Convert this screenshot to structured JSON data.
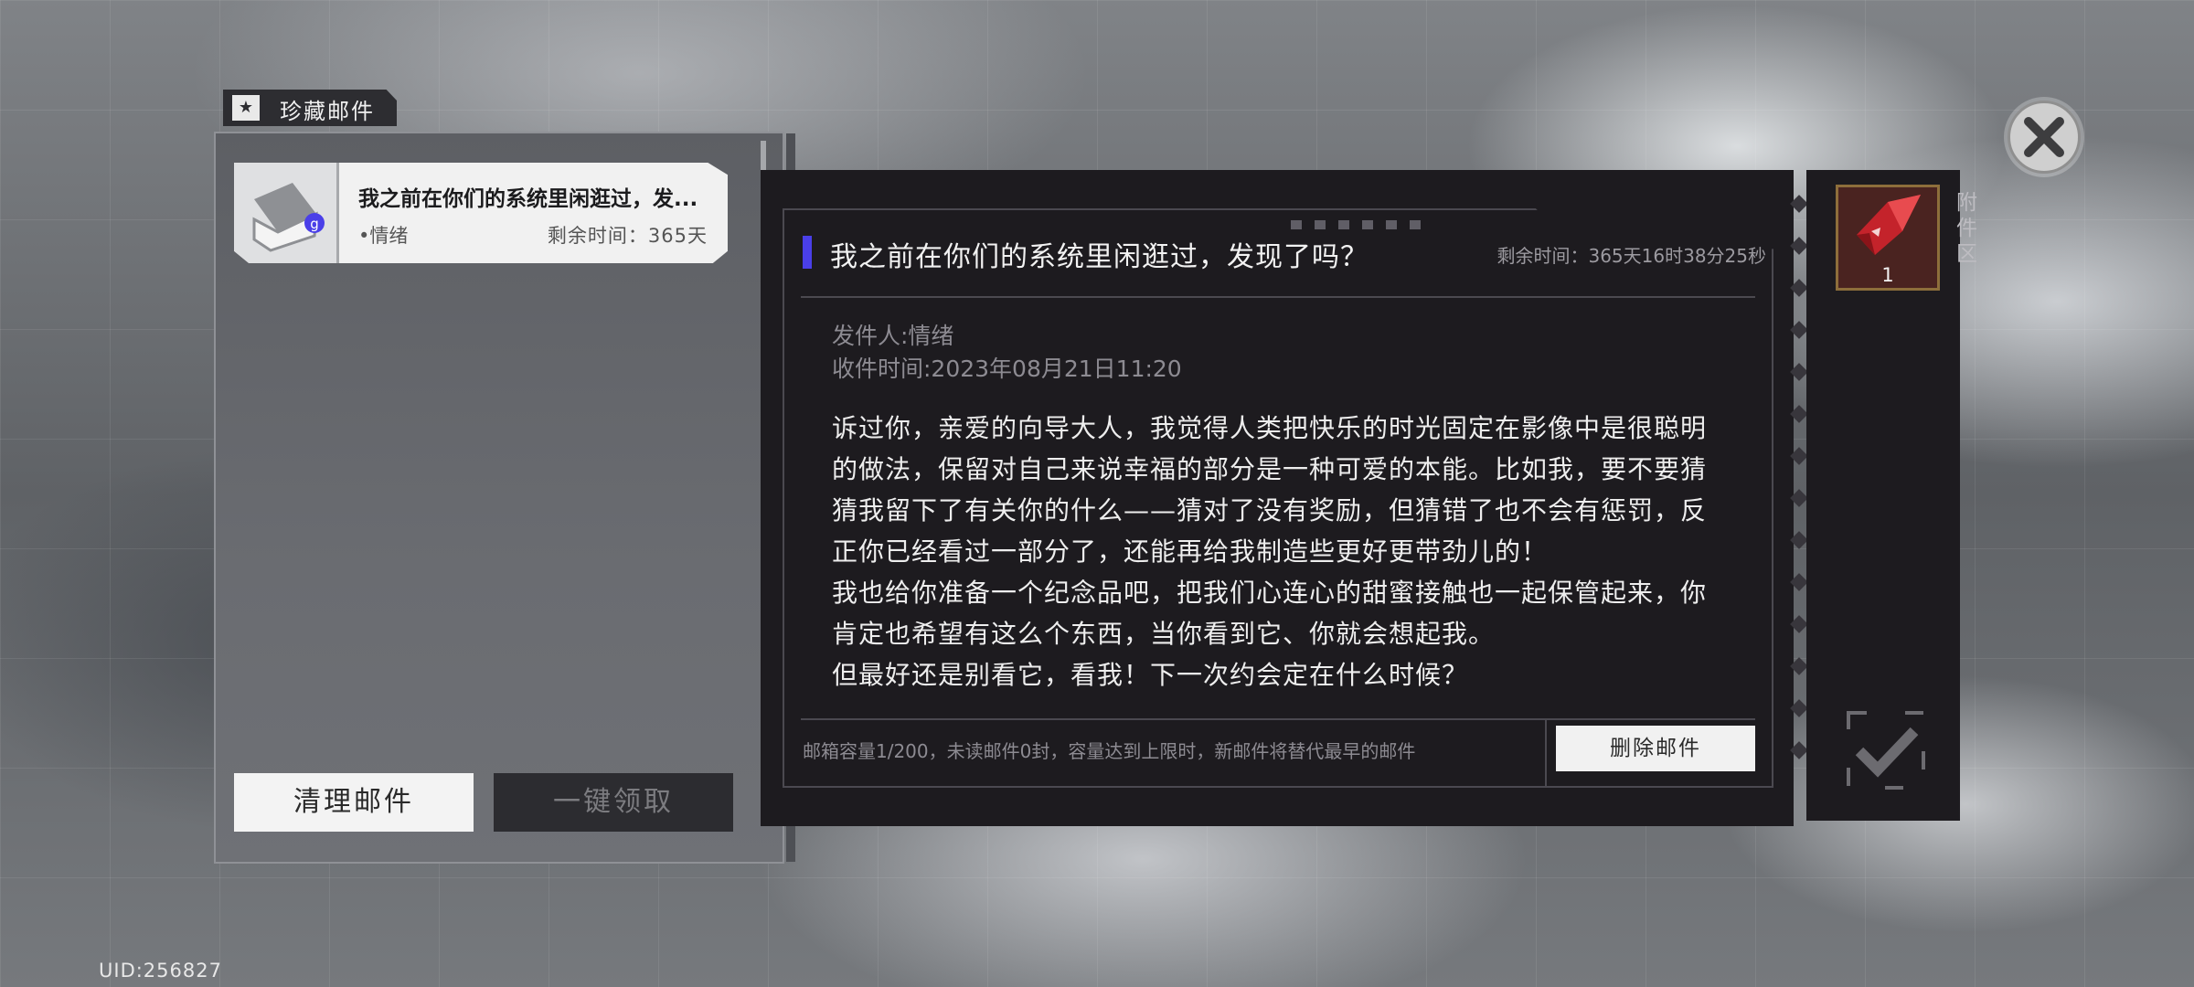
{
  "footer": {
    "uid": "UID:256827"
  },
  "list_panel": {
    "tab_label": "珍藏邮件",
    "mail_items": [
      {
        "subject": "我之前在你们的系统里闲逛过，发...",
        "sender": "•情绪",
        "remain": "剩余时间：365天"
      }
    ],
    "clean_label": "清理邮件",
    "claim_label": "一键领取"
  },
  "detail": {
    "title": "我之前在你们的系统里闲逛过，发现了吗？",
    "remain_full": "剩余时间：365天16时38分25秒",
    "sender": "发件人:情绪",
    "received": "收件时间:2023年08月21日11:20",
    "body": [
      "诉过你，亲爱的向导大人，我觉得人类把快乐的时光固定在影像中是很聪明的做法，保留对自己来说幸福的部分是一种可爱的本能。比如我，要不要猜猜我留下了有关你的什么——猜对了没有奖励，但猜错了也不会有惩罚，反正你已经看过一部分了，还能再给我制造些更好更带劲儿的！",
      "我也给你准备一个纪念品吧，把我们心连心的甜蜜接触也一起保管起来，你肯定也希望有这么个东西，当你看到它、你就会想起我。",
      "但最好还是别看它，看我！下一次约会定在什么时候？"
    ],
    "capacity": "邮箱容量1/200，未读邮件0封，容量达到上限时，新邮件将替代最早的邮件",
    "delete_label": "删除邮件"
  },
  "attachment": {
    "label": "附件区",
    "item_icon": "red-crystal-icon",
    "item_count": "1"
  },
  "colors": {
    "accent": "#4a3fe8",
    "panel": "#1d1b1f",
    "item_border": "#8d6e3b"
  }
}
